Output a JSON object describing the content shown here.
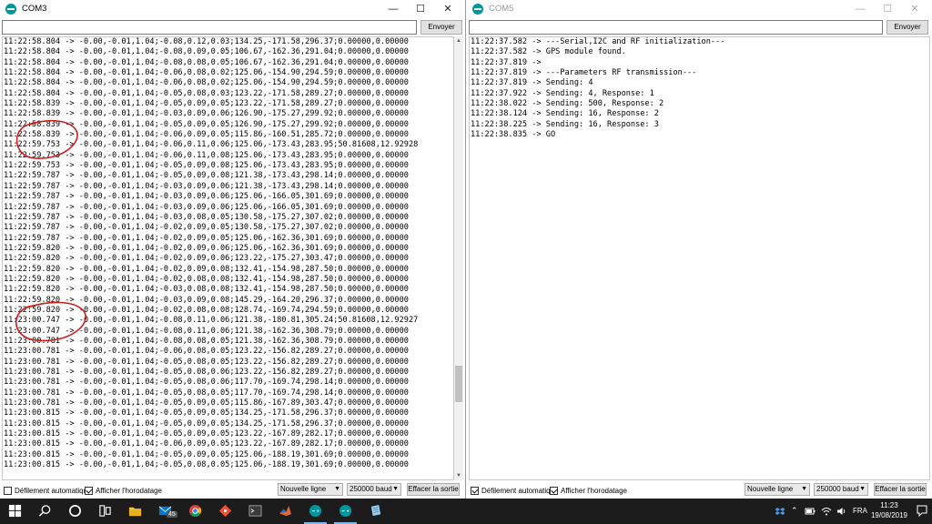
{
  "com3": {
    "title": "COM3",
    "send_label": "Envoyer",
    "input_value": "",
    "log": [
      "11:22:58.804 -> -0.00,-0.01,1.04;-0.08,0.12,0.03;134.25,-171.58,296.37;0.00000,0.00000",
      "11:22:58.804 -> -0.00,-0.01,1.04;-0.08,0.09,0.05;106.67,-162.36,291.04;0.00000,0.00000",
      "11:22:58.804 -> -0.00,-0.01,1.04;-0.08,0.08,0.05;106.67,-162.36,291.04;0.00000,0.00000",
      "11:22:58.804 -> -0.00,-0.01,1.04;-0.06,0.08,0.02;125.06,-154.90,294.59;0.00000,0.00000",
      "11:22:58.804 -> -0.00,-0.01,1.04;-0.06,0.08,0.02;125.06,-154.90,294.59;0.00000,0.00000",
      "11:22:58.804 -> -0.00,-0.01,1.04;-0.05,0.08,0.03;123.22,-171.58,289.27;0.00000,0.00000",
      "11:22:58.839 -> -0.00,-0.01,1.04;-0.05,0.09,0.05;123.22,-171.58,289.27;0.00000,0.00000",
      "11:22:58.839 -> -0.00,-0.01,1.04;-0.03,0.09,0.06;126.90,-175.27,299.92;0.00000,0.00000",
      "11:22:58.839 -> -0.00,-0.01,1.04;-0.05,0.09,0.05;126.90,-175.27,299.92;0.00000,0.00000",
      "11:22:58.839 -> -0.00,-0.01,1.04;-0.06,0.09,0.05;115.86,-160.51,285.72;0.00000,0.00000",
      "11:22:59.753 -> -0.00,-0.01,1.04;-0.06,0.11,0.06;125.06,-173.43,283.95;50.81608,12.92928",
      "11:22:59.753 -> -0.00,-0.01,1.04;-0.06,0.11,0.08;125.06,-173.43,283.95;0.00000,0.00000",
      "11:22:59.753 -> -0.00,-0.01,1.04;-0.05,0.09,0.08;125.06,-173.43,283.95;0.00000,0.00000",
      "11:22:59.787 -> -0.00,-0.01,1.04;-0.05,0.09,0.08;121.38,-173.43,298.14;0.00000,0.00000",
      "11:22:59.787 -> -0.00,-0.01,1.04;-0.03,0.09,0.06;121.38,-173.43,298.14;0.00000,0.00000",
      "11:22:59.787 -> -0.00,-0.01,1.04;-0.03,0.09,0.06;125.06,-166.05,301.69;0.00000,0.00000",
      "11:22:59.787 -> -0.00,-0.01,1.04;-0.03,0.09,0.06;125.06,-166.05,301.69;0.00000,0.00000",
      "11:22:59.787 -> -0.00,-0.01,1.04;-0.03,0.08,0.05;130.58,-175.27,307.02;0.00000,0.00000",
      "11:22:59.787 -> -0.00,-0.01,1.04;-0.02,0.09,0.05;130.58,-175.27,307.02;0.00000,0.00000",
      "11:22:59.787 -> -0.00,-0.01,1.04;-0.02,0.09,0.05;125.06,-162.36,301.69;0.00000,0.00000",
      "11:22:59.820 -> -0.00,-0.01,1.04;-0.02,0.09,0.06;125.06,-162.36,301.69;0.00000,0.00000",
      "11:22:59.820 -> -0.00,-0.01,1.04;-0.02,0.09,0.06;123.22,-175.27,303.47;0.00000,0.00000",
      "11:22:59.820 -> -0.00,-0.01,1.04;-0.02,0.09,0.08;132.41,-154.98,287.50;0.00000,0.00000",
      "11:22:59.820 -> -0.00,-0.01,1.04;-0.02,0.08,0.08;132.41,-154.98,287.50;0.00000,0.00000",
      "11:22:59.820 -> -0.00,-0.01,1.04;-0.03,0.08,0.08;132.41,-154.98,287.50;0.00000,0.00000",
      "11:22:59.820 -> -0.00,-0.01,1.04;-0.03,0.09,0.08;145.29,-164.20,296.37;0.00000,0.00000",
      "11:22:59.820 -> -0.00,-0.01,1.04;-0.02,0.08,0.08;128.74,-169.74,294.59;0.00000,0.00000",
      "11:23:00.747 -> -0.00,-0.01,1.04;-0.08,0.11,0.06;121.38,-180.81,305.24;50.81608,12.92927",
      "11:23:00.747 -> -0.00,-0.01,1.04;-0.08,0.11,0.06;121.38,-162.36,308.79;0.00000,0.00000",
      "11:23:00.781 -> -0.00,-0.01,1.04;-0.08,0.08,0.05;121.38,-162.36,308.79;0.00000,0.00000",
      "11:23:00.781 -> -0.00,-0.01,1.04;-0.06,0.08,0.05;123.22,-156.82,289.27;0.00000,0.00000",
      "11:23:00.781 -> -0.00,-0.01,1.04;-0.05,0.08,0.05;123.22,-156.82,289.27;0.00000,0.00000",
      "11:23:00.781 -> -0.00,-0.01,1.04;-0.05,0.08,0.06;123.22,-156.82,289.27;0.00000,0.00000",
      "11:23:00.781 -> -0.00,-0.01,1.04;-0.05,0.08,0.06;117.70,-169.74,298.14;0.00000,0.00000",
      "11:23:00.781 -> -0.00,-0.01,1.04;-0.05,0.08,0.05;117.70,-169.74,298.14;0.00000,0.00000",
      "11:23:00.781 -> -0.00,-0.01,1.04;-0.05,0.09,0.05;115.86,-167.89,303.47;0.00000,0.00000",
      "11:23:00.815 -> -0.00,-0.01,1.04;-0.05,0.09,0.05;134.25,-171.58,296.37;0.00000,0.00000",
      "11:23:00.815 -> -0.00,-0.01,1.04;-0.05,0.09,0.05;134.25,-171.58,296.37;0.00000,0.00000",
      "11:23:00.815 -> -0.00,-0.01,1.04;-0.05,0.09,0.05;123.22,-167.89,282.17;0.00000,0.00000",
      "11:23:00.815 -> -0.00,-0.01,1.04;-0.06,0.09,0.05;123.22,-167.89,282.17;0.00000,0.00000",
      "11:23:00.815 -> -0.00,-0.01,1.04;-0.05,0.09,0.05;125.06,-188.19,301.69;0.00000,0.00000",
      "11:23:00.815 -> -0.00,-0.01,1.04;-0.05,0.08,0.05;125.06,-188.19,301.69;0.00000,0.00000"
    ],
    "autoscroll_label": "Défilement automatique",
    "autoscroll_checked": false,
    "timestamp_label": "Afficher l'horodatage",
    "timestamp_checked": true,
    "line_ending": "Nouvelle ligne",
    "baud": "250000 baud",
    "clear_label": "Effacer la sortie"
  },
  "com5": {
    "title": "COM5",
    "send_label": "Envoyer",
    "input_value": "",
    "log": [
      "11:22:37.582 -> ---Serial,I2C and RF initialization---",
      "11:22:37.582 -> GPS module found.",
      "11:22:37.819 ->",
      "11:22:37.819 -> ---Parameters RF transmission---",
      "11:22:37.819 -> Sending: 4",
      "11:22:37.922 -> Sending: 4, Response: 1",
      "11:22:38.022 -> Sending: 500, Response: 2",
      "11:22:38.124 -> Sending: 16, Response: 2",
      "11:22:38.225 -> Sending: 16, Response: 3",
      "11:22:38.835 -> GO"
    ],
    "autoscroll_label": "Défilement automatique",
    "autoscroll_checked": true,
    "timestamp_label": "Afficher l'horodatage",
    "timestamp_checked": true,
    "line_ending": "Nouvelle ligne",
    "baud": "250000 baud",
    "clear_label": "Effacer la sortie"
  },
  "taskbar": {
    "badge": "45",
    "language": "FRA",
    "time": "11:23",
    "date": "19/08/2019"
  },
  "colors": {
    "arduino_teal": "#00979c",
    "annotation_red": "#d11a1a",
    "taskbar_bg": "#1c1c1c"
  }
}
